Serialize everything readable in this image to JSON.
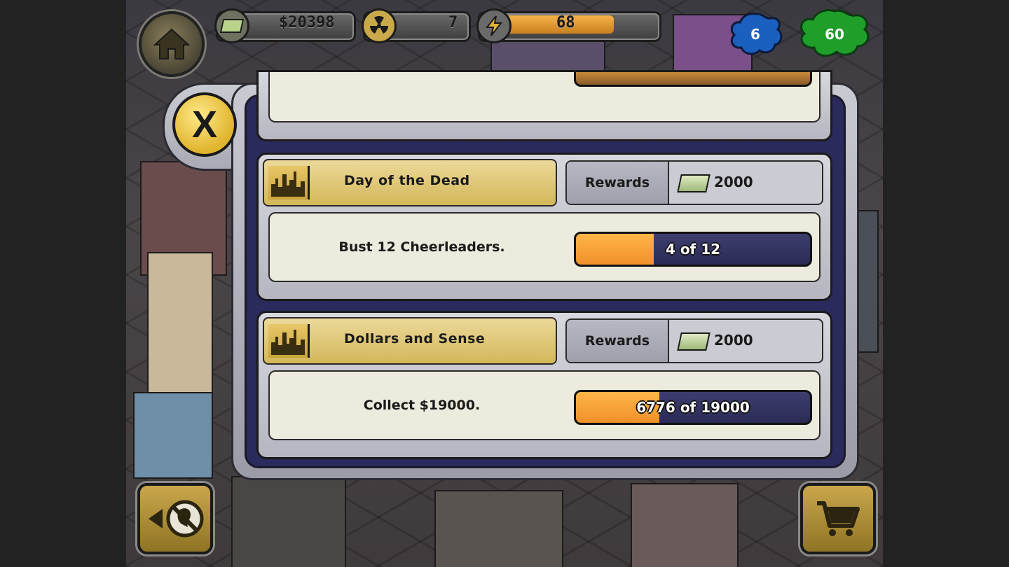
{
  "hud": {
    "money": "$20398",
    "radiation": "7",
    "energy": "68",
    "energy_level": 0.78,
    "blue_slime": "6",
    "green_slime": "60"
  },
  "panel": {
    "close_label": "X",
    "rewards_label": "Rewards",
    "missions": [
      {
        "title": "Day of the Dead",
        "reward": "2000",
        "task": "Bust 12 Cheerleaders.",
        "progress_text": "4 of 12",
        "progress_fraction": 0.333
      },
      {
        "title": "Dollars and Sense",
        "reward": "2000",
        "task": "Collect $19000.",
        "progress_text": "6776 of 19000",
        "progress_fraction": 0.357
      }
    ]
  },
  "colors": {
    "panel_bg": "#2a2a5c",
    "title_gold": "#d3b75a",
    "progress_orange": "#f0902a",
    "progress_track": "#2a2b55",
    "blue_slime": "#1b5fbf",
    "green_slime": "#1f9e2a"
  },
  "icons": [
    "home-icon",
    "cash-icon",
    "radiation-icon",
    "lightning-icon",
    "close-icon",
    "city-skyline-icon",
    "ghostbusters-back-icon",
    "shopping-cart-icon"
  ]
}
